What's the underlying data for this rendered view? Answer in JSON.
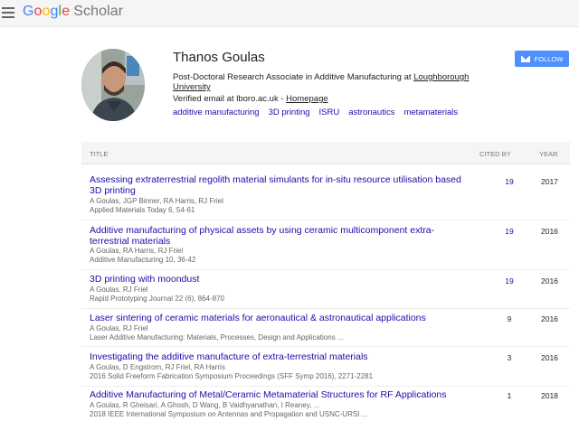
{
  "app": {
    "logo_google": [
      "G",
      "o",
      "o",
      "g",
      "l",
      "e"
    ],
    "logo_scholar": "Scholar"
  },
  "profile": {
    "name": "Thanos Goulas",
    "affiliation_prefix": "Post-Doctoral Research Associate in Additive Manufacturing at ",
    "affiliation_link": "Loughborough University",
    "email_text": "Verified email at lboro.ac.uk - ",
    "homepage_label": "Homepage",
    "interests": [
      "additive manufacturing",
      "3D printing",
      "ISRU",
      "astronautics",
      "metamaterials"
    ],
    "follow_label": "FOLLOW"
  },
  "table": {
    "headers": {
      "title": "TITLE",
      "cited_by": "CITED BY",
      "year": "YEAR"
    },
    "rows": [
      {
        "title": "Assessing extraterrestrial regolith material simulants for in-situ resource utilisation based 3D printing",
        "authors": "A Goulas, JGP Binner, RA Harris, RJ Friel",
        "venue": "Applied Materials Today 6, 54-61",
        "cited": "19",
        "year": "2017"
      },
      {
        "title": "Additive manufacturing of physical assets by using ceramic multicomponent extra-terrestrial materials",
        "authors": "A Goulas, RA Harris, RJ Friel",
        "venue": "Additive Manufacturing 10, 36-42",
        "cited": "19",
        "year": "2016"
      },
      {
        "title": "3D printing with moondust",
        "authors": "A Goulas, RJ Friel",
        "venue": "Rapid Prototyping Journal 22 (6), 864-870",
        "cited": "19",
        "year": "2016"
      },
      {
        "title": "Laser sintering of ceramic materials for aeronautical & astronautical applications",
        "authors": "A Goulas, RJ Friel",
        "venue": "Laser Additive Manufacturing: Materials, Processes, Design and Applications ...",
        "cited": "9",
        "year": "2016"
      },
      {
        "title": "Investigating the additive manufacture of extra-terrestrial materials",
        "authors": "A Goulas, D Engstrom, RJ Friel, RA Harris",
        "venue": "2016 Solid Freeform Fabrication Symposium Proceedings (SFF Symp 2016), 2271-2281",
        "cited": "3",
        "year": "2016"
      },
      {
        "title": "Additive Manufacturing of Metal/Ceramic Metamaterial Structures for RF Applications",
        "authors": "A Goulas, R Gheisari, A Ghosh, D Wang, B Vaidhyanathan, I Reaney, ...",
        "venue": "2018 IEEE International Symposium on Antennas and Propagation and USNC-URSI ...",
        "cited": "1",
        "year": "2018"
      }
    ]
  },
  "colors": {
    "link": "#1a0dab",
    "follow_button": "#4d90fe",
    "header_bg": "#f5f5f5"
  }
}
